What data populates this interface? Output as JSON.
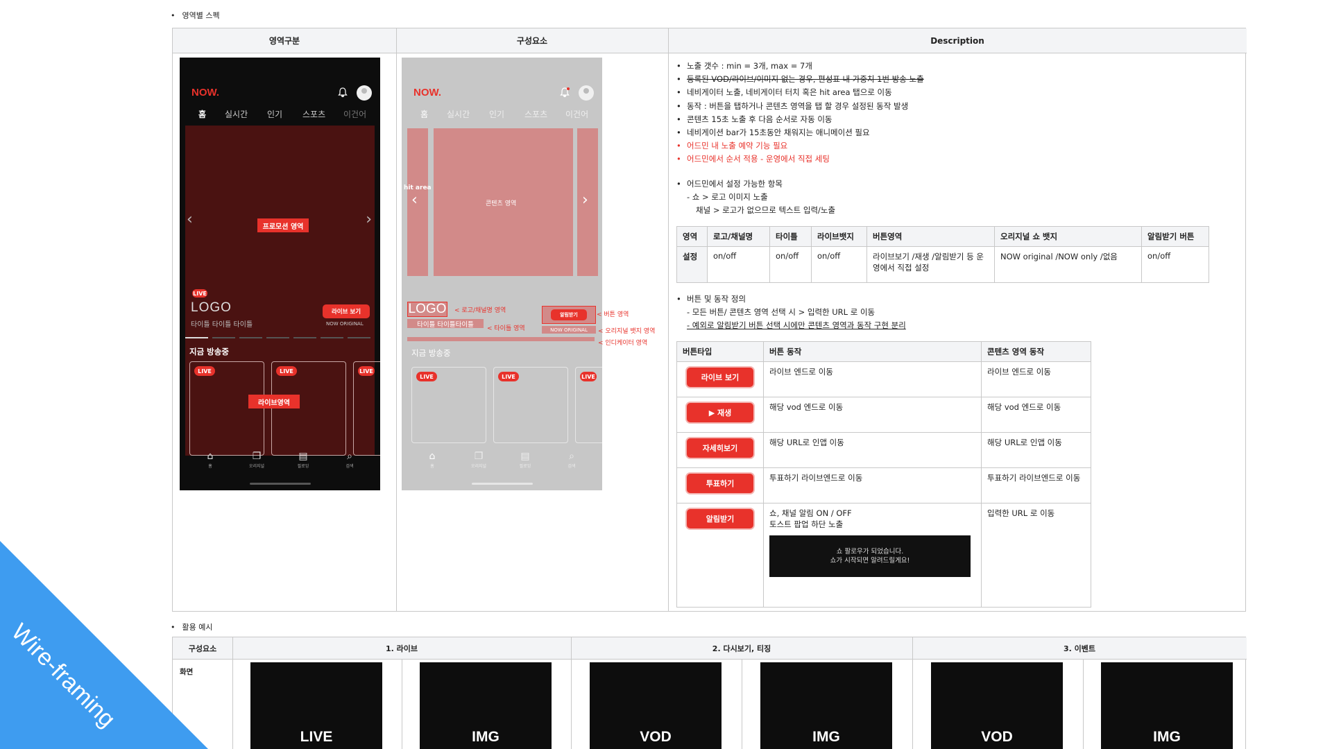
{
  "section1_title": "영역별 스펙",
  "spec_headers": [
    "영역구분",
    "구성요소",
    "Description"
  ],
  "phone": {
    "brand": "NOW.",
    "tabs": [
      "홈",
      "실시간",
      "인기",
      "스포츠",
      "이건어"
    ],
    "promo_label": "프로모션 영역",
    "live_badge": "LIVE",
    "logo_text": "LOGO",
    "title_text": "타이틀 타이틀 타이틀",
    "live_button": "라이브 보기",
    "original_badge": "NOW ORIGINAL",
    "now_on_air": "지금 방송중",
    "live_area_label": "라이브영역",
    "nav": [
      "홈",
      "오리지널",
      "필로잉",
      "검색"
    ]
  },
  "component": {
    "brand": "NOW.",
    "tabs": [
      "홈",
      "실시간",
      "인기",
      "스포츠",
      "이건어"
    ],
    "hit_area": "hit area",
    "content_area": "콘텐츠 영역",
    "logo_text": "LOGO",
    "title_text": "타이틀 타이틀타이틀",
    "alarm_button": "알림받기",
    "original_badge": "NOW ORIGINAL",
    "annotations": {
      "logo": "< 로고/채널명 영역",
      "button": "< 버튼 영역",
      "title": "< 타이틀 영역",
      "original": "< 오리지널 뱃지 영역",
      "indicator": "< 인디케이터 영역"
    },
    "now_on_air": "지금 방송중",
    "live_badge": "LIVE",
    "nav": [
      "홈",
      "오리지널",
      "필로잉",
      "검색"
    ]
  },
  "description": {
    "bullets": [
      {
        "text": "노출 갯수 : min = 3개,  max = 7개",
        "style": "normal"
      },
      {
        "text": "등록된 VOD/라이브/이미지 없는 경우, 편성표 내 가중치 1번 방송 노출",
        "style": "strike"
      },
      {
        "text": "네비게이터 노출, 네비게이터 터치 혹은 hit area 탭으로 이동",
        "style": "normal"
      },
      {
        "text": "동작 : 버튼을 탭하거나 콘텐츠 영역을 탭 할 경우 설정된 동작 발생",
        "style": "normal"
      },
      {
        "text": "콘텐츠 15초 노출 후 다음 순서로 자동 이동",
        "style": "normal"
      },
      {
        "text": "네비게이션 bar가 15초동안 채워지는 애니메이션 필요",
        "style": "normal"
      },
      {
        "text": "어드민 내 노출 예약 기능 필요",
        "style": "red"
      },
      {
        "text": "어드민에서 순서 적용 - 운영에서 직접 세팅",
        "style": "red"
      }
    ],
    "admin_title": "어드민에서 설정 가능한 항목",
    "admin_line1": "- 쇼 > 로고 이미지 노출",
    "admin_line2": "채널 > 로고가 없으므로 텍스트 입력/노출",
    "settings_table": {
      "headers": [
        "영역",
        "로고/채널명",
        "타이틀",
        "라이브뱃지",
        "버튼영역",
        "오리지널 쇼 뱃지",
        "알림받기 버튼"
      ],
      "row": [
        "설정",
        "on/off",
        "on/off",
        "on/off",
        "라이브보기 /재생 /알림받기 등 운영에서 직접 설정",
        "NOW original /NOW only /없음",
        "on/off"
      ]
    },
    "button_title": "버튼 및 동작 정의",
    "button_line1": "- 모든 버튼/ 콘텐츠 영역 선택 시 > 입력한 URL 로 이동",
    "button_line2": "- 예외로 알림받기 버튼 선택 시에만 콘텐츠 영역과 동작 구현 분리",
    "button_table": {
      "headers": [
        "버튼타입",
        "버튼 동작",
        "콘텐츠 영역 동작"
      ],
      "rows": [
        {
          "button": "라이브 보기",
          "action": "라이브 엔드로 이동",
          "content": "라이브 엔드로 이동"
        },
        {
          "button": "▶ 재생",
          "action": "해당 vod 엔드로 이동",
          "content": "해당 vod 엔드로 이동"
        },
        {
          "button": "자세히보기",
          "action": "해당 URL로 인앱 이동",
          "content": "해당 URL로 인앱 이동"
        },
        {
          "button": "투표하기",
          "action": "투표하기 라이브엔드로 이동",
          "content": "투표하기 라이브엔드로 이동"
        },
        {
          "button": "알림받기",
          "action": "쇼, 채널 알림 ON / OFF",
          "action2": "토스트 팝업 하단 노출",
          "content": "입력한 URL 로 이동"
        }
      ],
      "toast_line1": "쇼 팔로우가 되었습니다.",
      "toast_line2": "쇼가 시작되면 알려드릴게요!"
    }
  },
  "section2_title": "활용 예시",
  "usage": {
    "row_header": "구성요소",
    "row_label": "화면",
    "groups": [
      "1. 라이브",
      "2. 다시보기, 티징",
      "3. 이벤트"
    ],
    "thumbs": [
      "LIVE",
      "IMG",
      "VOD",
      "IMG",
      "VOD",
      "IMG"
    ]
  },
  "ribbon_text": "Wire-framing"
}
